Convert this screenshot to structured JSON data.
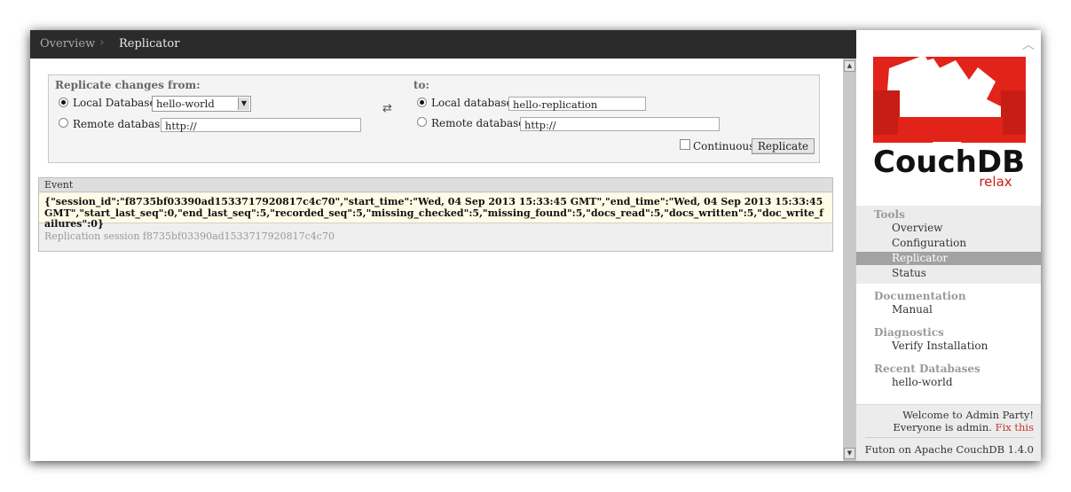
{
  "breadcrumb": {
    "overview": "Overview",
    "separator": "›",
    "current": "Replicator"
  },
  "form": {
    "from_label": "Replicate changes from:",
    "to_label": "to:",
    "local_db_from_label": "Local Database:",
    "local_db_from_value": "hello-world",
    "remote_db_from_label": "Remote database:",
    "remote_db_from_value": "http://",
    "swap_symbol": "⇄",
    "local_db_to_label": "Local database:",
    "local_db_to_value": "hello-replication",
    "remote_db_to_label": "Remote database:",
    "remote_db_to_value": "http://",
    "continuous_label": "Continuous",
    "replicate_button": "Replicate"
  },
  "events": {
    "header": "Event",
    "row_text": "{\"session_id\":\"f8735bf03390ad1533717920817c4c70\",\"start_time\":\"Wed, 04 Sep 2013 15:33:45 GMT\",\"end_time\":\"Wed, 04 Sep 2013 15:33:45 GMT\",\"start_last_seq\":0,\"end_last_seq\":5,\"recorded_seq\":5,\"missing_checked\":5,\"missing_found\":5,\"docs_read\":5,\"docs_written\":5,\"doc_write_failures\":0}",
    "session_text": "Replication session f8735bf03390ad1533717920817c4c70"
  },
  "sidebar": {
    "logo_text": "CouchDB",
    "logo_tagline": "relax",
    "tools_heading": "Tools",
    "tools_items": [
      "Overview",
      "Configuration",
      "Replicator",
      "Status"
    ],
    "documentation_heading": "Documentation",
    "documentation_items": [
      "Manual"
    ],
    "diagnostics_heading": "Diagnostics",
    "diagnostics_items": [
      "Verify Installation"
    ],
    "recent_heading": "Recent Databases",
    "recent_items": [
      "hello-world"
    ],
    "welcome_line1": "Welcome to Admin Party!",
    "welcome_line2": "Everyone is admin.",
    "fix_link": "Fix this",
    "version": "Futon on Apache CouchDB 1.4.0"
  },
  "colors": {
    "topbar": "#2b2b2b",
    "logo_red": "#e2231a",
    "active_nav": "#a2a2a2",
    "fix_link": "#c0392b"
  }
}
